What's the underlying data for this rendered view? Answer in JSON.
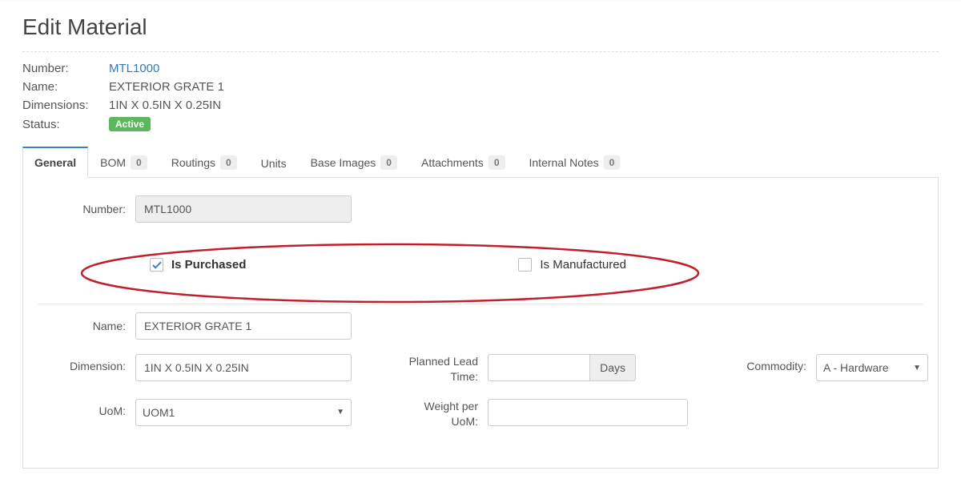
{
  "page_title": "Edit Material",
  "summary": {
    "number_label": "Number:",
    "number_value": "MTL1000",
    "name_label": "Name:",
    "name_value": "EXTERIOR GRATE 1",
    "dimensions_label": "Dimensions:",
    "dimensions_value": "1IN X 0.5IN X 0.25IN",
    "status_label": "Status:",
    "status_value": "Active"
  },
  "tabs": {
    "general": "General",
    "bom": "BOM",
    "bom_count": "0",
    "routings": "Routings",
    "routings_count": "0",
    "units": "Units",
    "base_images": "Base Images",
    "base_images_count": "0",
    "attachments": "Attachments",
    "attachments_count": "0",
    "internal_notes": "Internal Notes",
    "internal_notes_count": "0"
  },
  "form": {
    "number_label": "Number:",
    "number_value": "MTL1000",
    "is_purchased_label": "Is Purchased",
    "is_purchased_checked": true,
    "is_manufactured_label": "Is Manufactured",
    "is_manufactured_checked": false,
    "name_label": "Name:",
    "name_value": "EXTERIOR GRATE 1",
    "dimension_label": "Dimension:",
    "dimension_value": "1IN X 0.5IN X 0.25IN",
    "planned_lead_time_label": "Planned Lead Time:",
    "planned_lead_time_value": "",
    "planned_lead_time_unit": "Days",
    "commodity_label": "Commodity:",
    "commodity_value": "A - Hardware",
    "uom_label": "UoM:",
    "uom_value": "UOM1",
    "weight_per_uom_label": "Weight per UoM:",
    "weight_per_uom_value": ""
  }
}
